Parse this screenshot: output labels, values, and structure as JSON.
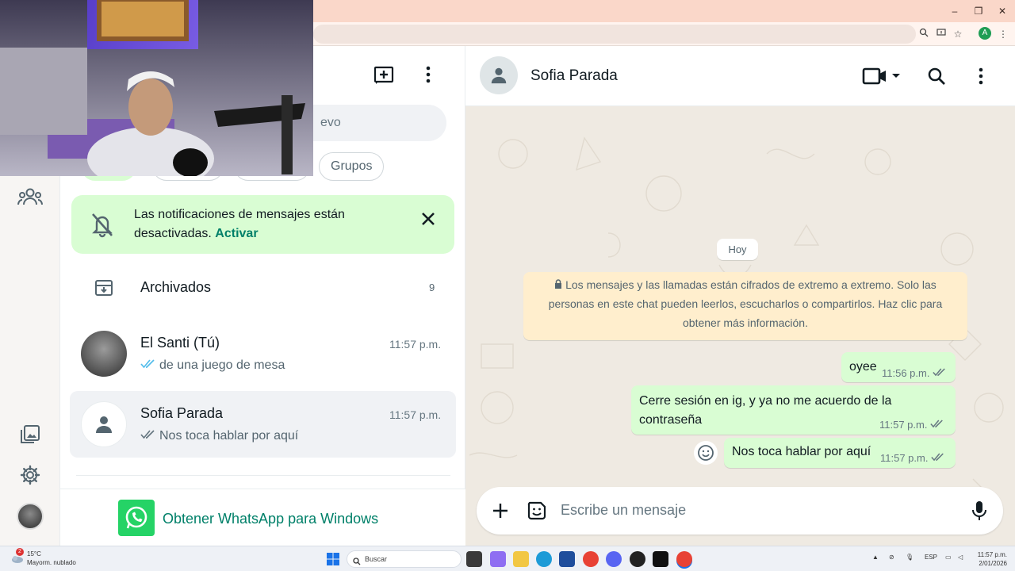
{
  "browser": {
    "window_controls": [
      "–",
      "❐",
      "✕"
    ],
    "profile_initial": "A"
  },
  "chat_list": {
    "search_placeholder": "Buscar un chat o iniciar uno nuevo",
    "search_visible_text": "evo",
    "filters": [
      {
        "label": ""
      },
      {
        "label": ""
      },
      {
        "label": ""
      },
      {
        "label": "Grupos"
      }
    ],
    "notification": {
      "text": "Las notificaciones de mensajes están desactivadas.",
      "action": "Activar"
    },
    "archived": {
      "label": "Archivados",
      "count": "9"
    },
    "chats": [
      {
        "name": "El Santi (Tú)",
        "time": "11:57 p.m.",
        "preview": "de una juego de mesa",
        "ticks": "read"
      },
      {
        "name": "Sofia Parada",
        "time": "11:57 p.m.",
        "preview": "Nos toca hablar por aquí",
        "ticks": "sent"
      }
    ],
    "get_app": "Obtener WhatsApp para Windows"
  },
  "conversation": {
    "contact_name": "Sofia Parada",
    "day_label": "Hoy",
    "encryption_notice": "Los mensajes y las llamadas están cifrados de extremo a extremo. Solo las personas en este chat pueden leerlos, escucharlos o compartirlos. Haz clic para obtener más información.",
    "messages": [
      {
        "text": "oyee",
        "time": "11:56 p.m."
      },
      {
        "text": "Cerre sesión en ig, y ya no me acuerdo de la contraseña",
        "time": "11:57 p.m."
      },
      {
        "text": "Nos toca hablar por aquí",
        "time": "11:57 p.m."
      }
    ],
    "composer_placeholder": "Escribe un mensaje"
  },
  "taskbar": {
    "weather_temp": "15°C",
    "weather_desc": "Mayorm. nublado",
    "weather_badge": "2",
    "search_label": "Buscar",
    "language": "ESP",
    "time": "11:57 p.m.",
    "date": "2/01/2026"
  },
  "colors": {
    "accent_green": "#008069",
    "bubble_out": "#d9fdd3",
    "notice_yellow": "#ffeecd"
  }
}
